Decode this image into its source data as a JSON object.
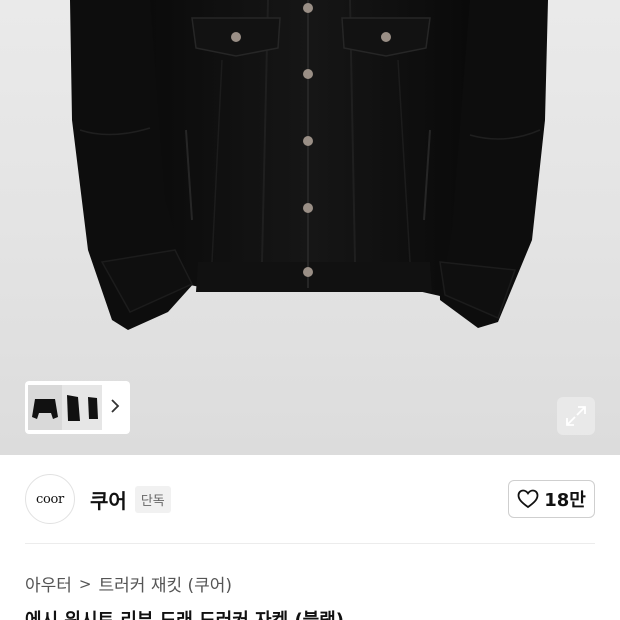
{
  "product": {
    "image_alt": "black denim trucker jacket",
    "thumbnail_count": 3
  },
  "brand": {
    "logo_text": "coor",
    "name": "쿠어",
    "badge": "단독"
  },
  "like": {
    "count": "18만",
    "icon": "heart-icon"
  },
  "breadcrumb": {
    "category": "아우터",
    "separator": ">",
    "subcategory": "트러커 재킷 (쿠어)"
  },
  "title": "에시 위시트 리부 드래 드러커 자켓 (블랙)",
  "icons": {
    "thumb_arrow": "chevron-right-icon",
    "expand": "expand-icon"
  },
  "colors": {
    "hero_bg": "#e5e5e5",
    "text": "#111111",
    "muted": "#555555"
  }
}
